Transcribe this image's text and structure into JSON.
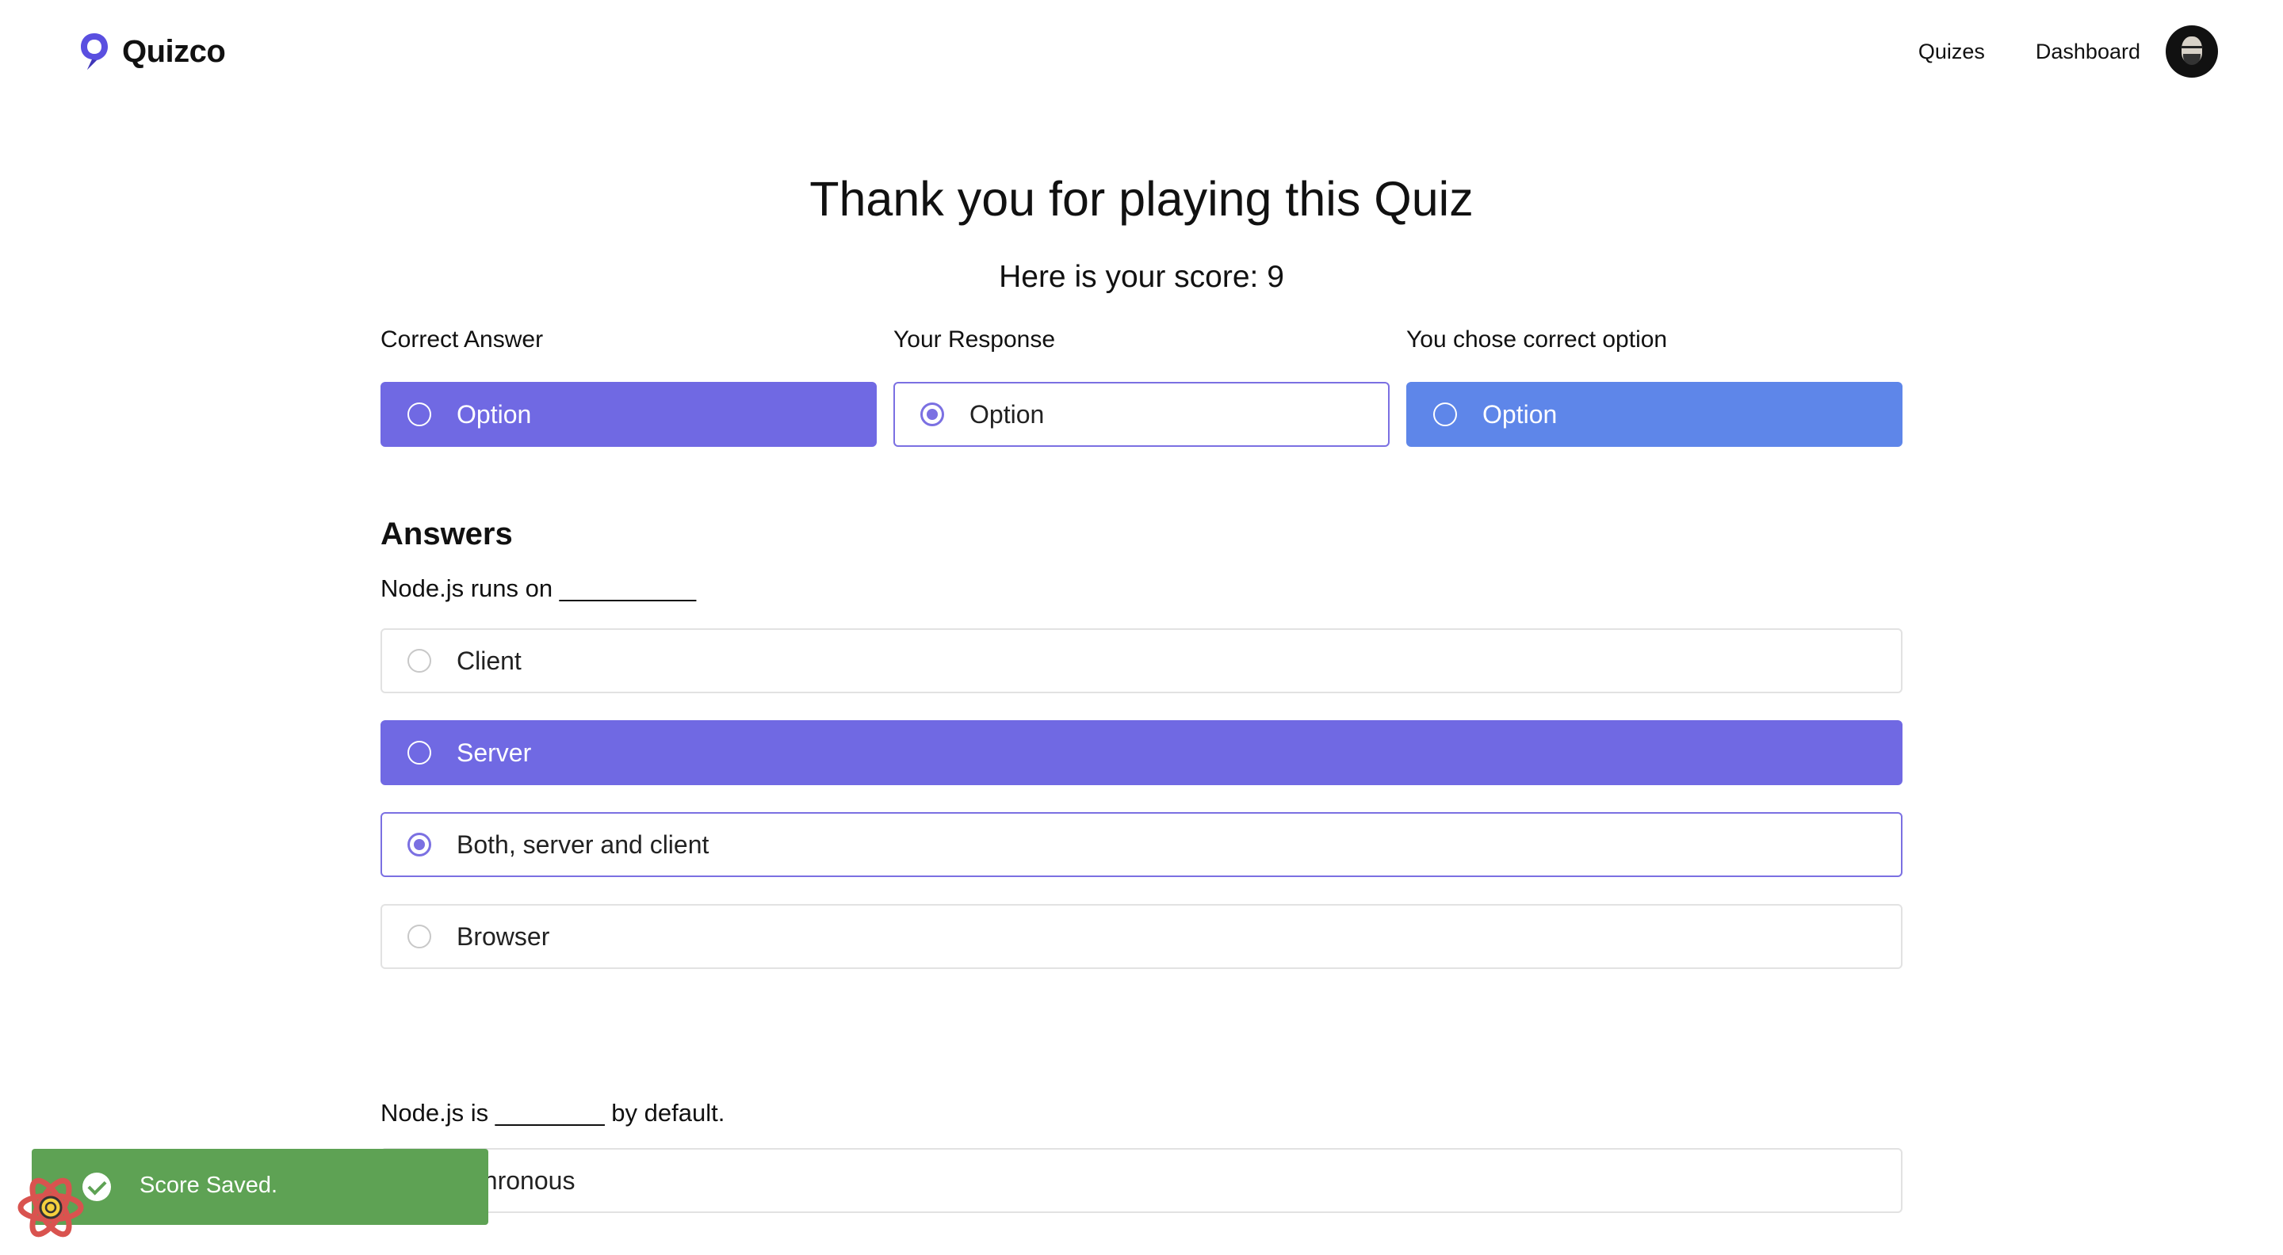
{
  "brand": {
    "name": "Quizco",
    "accent": "#7069e3"
  },
  "nav": {
    "items": [
      "Quizes",
      "Dashboard"
    ]
  },
  "result": {
    "title": "Thank you for playing this Quiz",
    "score_text": "Here is your score: 9"
  },
  "legend": {
    "correct_label": "Correct Answer",
    "response_label": "Your Response",
    "chosen_correct_label": "You chose correct option",
    "option_text": "Option",
    "colors": {
      "correct": "#7069e3",
      "response": "#7b70e2",
      "chosen_correct": "#5e86e9"
    }
  },
  "answers": {
    "heading": "Answers",
    "questions": [
      {
        "text": "Node.js runs on __________",
        "options": [
          "Client",
          "Server",
          "Both, server and client",
          "Browser"
        ],
        "correct_option": "Server",
        "your_response": "Both, server and client"
      },
      {
        "text": "Node.js is ________ by default.",
        "options": [
          "nchronous"
        ]
      }
    ]
  },
  "toast": {
    "message": "Score Saved.",
    "color": "#5ea254"
  },
  "icons": [
    "quizco-logo-icon",
    "check-icon",
    "react-devtools-icon"
  ]
}
